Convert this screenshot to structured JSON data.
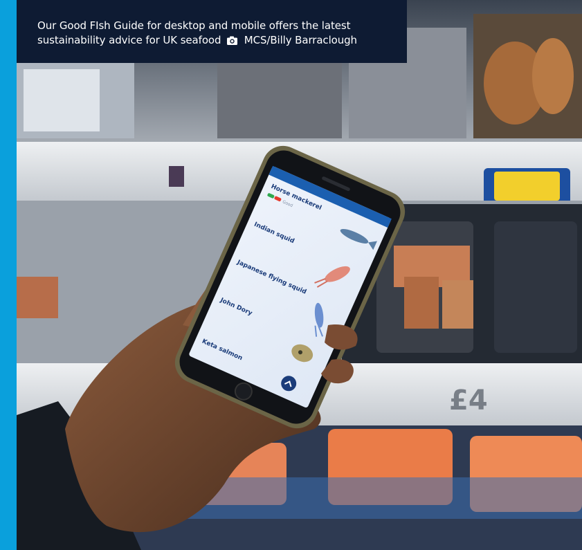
{
  "caption": {
    "line1": "Our Good FIsh Guide for desktop and mobile offers the latest",
    "line2": "sustainability advice for UK seafood",
    "credit": "MCS/Billy Barraclough",
    "credit_icon": "camera-icon"
  },
  "phone_screen": {
    "items": [
      {
        "name": "Horse mackerel",
        "rating": "Good",
        "icon": "mackerel-icon"
      },
      {
        "name": "Indian squid",
        "icon": "squid-icon"
      },
      {
        "name": "Japanese flying squid",
        "icon": "flying-squid-icon"
      },
      {
        "name": "John Dory",
        "icon": "john-dory-icon"
      },
      {
        "name": "Keta salmon"
      }
    ],
    "scroll_icon": "chevron-up-icon"
  },
  "colors": {
    "accent_stripe": "#0aa0dc",
    "caption_bg": "#0e1b33",
    "app_blue": "#1b5fb0"
  }
}
